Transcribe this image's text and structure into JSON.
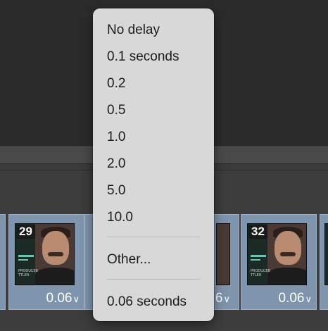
{
  "timeline": {
    "frames": [
      {
        "number": "",
        "delay": ""
      },
      {
        "number": "29",
        "delay": "0.06"
      },
      {
        "number": "",
        "delay": "6"
      },
      {
        "number": "32",
        "delay": "0.06"
      }
    ],
    "chevron": "∨",
    "thumb_caption": "PRODUCER\nTTLER"
  },
  "delay_menu": {
    "items": [
      "No delay",
      "0.1 seconds",
      "0.2",
      "0.5",
      "1.0",
      "2.0",
      "5.0",
      "10.0"
    ],
    "other_label": "Other...",
    "current_label": "0.06 seconds"
  }
}
